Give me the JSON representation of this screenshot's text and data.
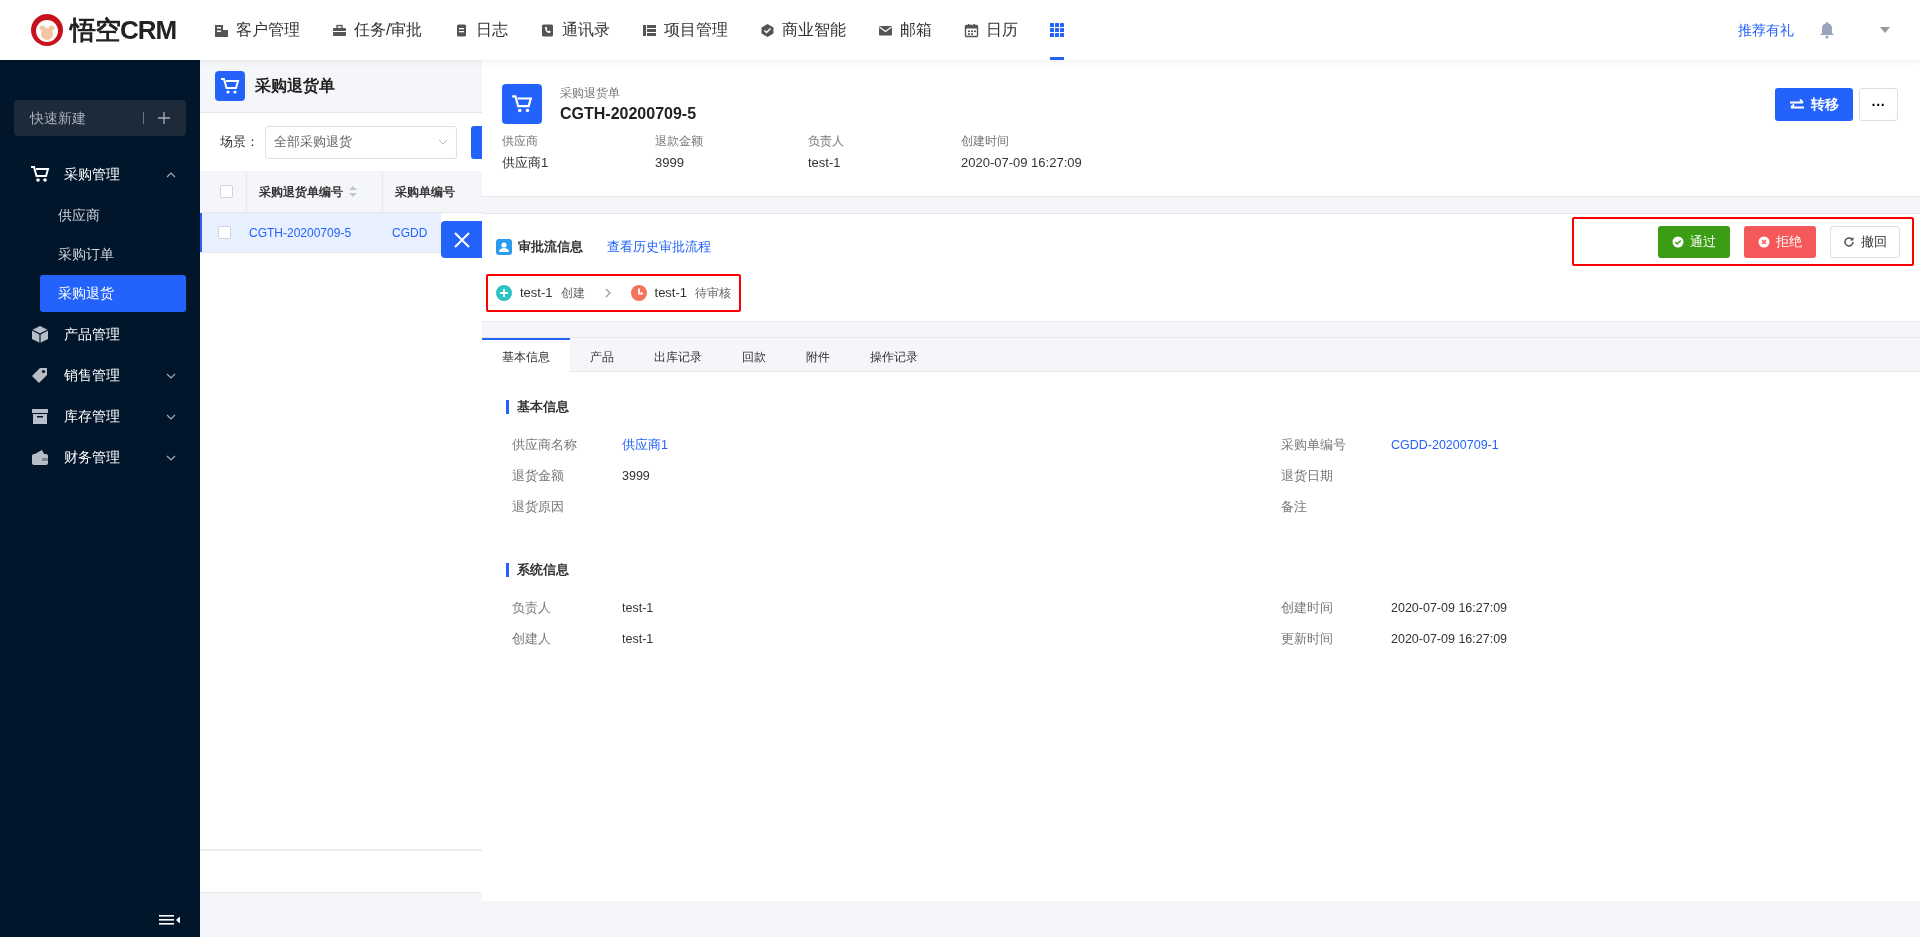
{
  "app": {
    "logo_text": "悟空CRM"
  },
  "top_nav": {
    "items": [
      {
        "label": "客户管理",
        "selected": false
      },
      {
        "label": "任务/审批",
        "selected": false
      },
      {
        "label": "日志",
        "selected": false
      },
      {
        "label": "通讯录",
        "selected": false
      },
      {
        "label": "项目管理",
        "selected": false
      },
      {
        "label": "商业智能",
        "selected": false
      },
      {
        "label": "邮箱",
        "selected": false
      },
      {
        "label": "日历",
        "selected": false
      }
    ],
    "apps_selected": true,
    "referral_link": "推荐有礼"
  },
  "sidebar": {
    "quick_create": "快速新建",
    "menu": [
      {
        "label": "采购管理",
        "expanded": true,
        "children": [
          {
            "label": "供应商",
            "selected": false
          },
          {
            "label": "采购订单",
            "selected": false
          },
          {
            "label": "采购退货",
            "selected": true
          }
        ]
      },
      {
        "label": "产品管理"
      },
      {
        "label": "销售管理",
        "expanded": false
      },
      {
        "label": "库存管理",
        "expanded": false
      },
      {
        "label": "财务管理",
        "expanded": false
      }
    ]
  },
  "list_panel": {
    "title": "采购退货单",
    "scene_label": "场景：",
    "scene_value": "全部采购退货",
    "all_checked": false,
    "columns": [
      "采购退货单编号",
      "采购单编号"
    ],
    "rows": [
      {
        "cells": [
          "CGTH-20200709-5",
          "CGDD"
        ],
        "selected": true,
        "checked": false
      }
    ]
  },
  "detail": {
    "type_label": "采购退货单",
    "number": "CGTH-20200709-5",
    "summary": [
      {
        "label": "供应商",
        "value": "供应商1"
      },
      {
        "label": "退款金额",
        "value": "3999"
      },
      {
        "label": "负责人",
        "value": "test-1"
      },
      {
        "label": "创建时间",
        "value": "2020-07-09 16:27:09"
      }
    ],
    "transfer_button": "转移",
    "more_button": "···"
  },
  "approval": {
    "title": "审批流信息",
    "history_link": "查看历史审批流程",
    "steps": [
      {
        "user": "test-1",
        "status": "创建",
        "kind": "created"
      },
      {
        "user": "test-1",
        "status": "待审核",
        "kind": "pending"
      }
    ],
    "actions": [
      {
        "label": "通过",
        "kind": "approve"
      },
      {
        "label": "拒绝",
        "kind": "reject"
      },
      {
        "label": "撤回",
        "kind": "revoke"
      }
    ]
  },
  "tabs": [
    {
      "label": "基本信息",
      "selected": true
    },
    {
      "label": "产品",
      "selected": false
    },
    {
      "label": "出库记录",
      "selected": false
    },
    {
      "label": "回款",
      "selected": false
    },
    {
      "label": "附件",
      "selected": false
    },
    {
      "label": "操作记录",
      "selected": false
    }
  ],
  "sections": [
    {
      "title": "基本信息",
      "fields": [
        {
          "label": "供应商名称",
          "value": "供应商1",
          "kind": "link"
        },
        {
          "label": "采购单编号",
          "value": "CGDD-20200709-1",
          "kind": "link"
        },
        {
          "label": "退货金额",
          "value": "3999",
          "kind": "text"
        },
        {
          "label": "退货日期"
        },
        {
          "label": "退货原因"
        },
        {
          "label": "备注"
        }
      ]
    },
    {
      "title": "系统信息",
      "fields": [
        {
          "label": "负责人",
          "value": "test-1",
          "kind": "text"
        },
        {
          "label": "创建时间",
          "value": "2020-07-09 16:27:09",
          "kind": "text"
        },
        {
          "label": "创建人",
          "value": "test-1",
          "kind": "text"
        },
        {
          "label": "更新时间",
          "value": "2020-07-09 16:27:09",
          "kind": "text"
        }
      ]
    }
  ]
}
